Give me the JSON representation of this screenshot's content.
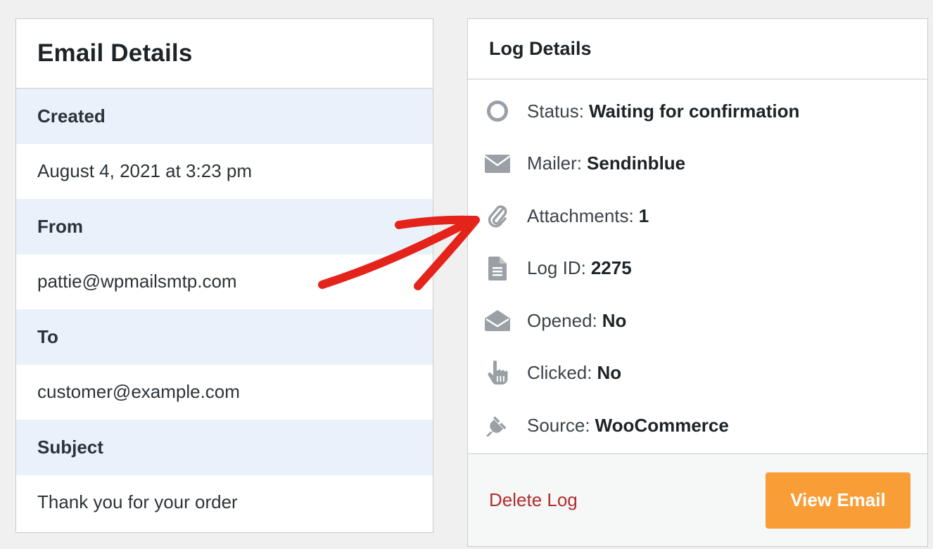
{
  "email_details": {
    "title": "Email Details",
    "rows": [
      {
        "label": "Created",
        "value": "August 4, 2021 at 3:23 pm"
      },
      {
        "label": "From",
        "value": "pattie@wpmailsmtp.com"
      },
      {
        "label": "To",
        "value": "customer@example.com"
      },
      {
        "label": "Subject",
        "value": "Thank you for your order"
      }
    ]
  },
  "log_details": {
    "title": "Log Details",
    "items": [
      {
        "icon": "status-circle-icon",
        "label": "Status:",
        "value": "Waiting for confirmation"
      },
      {
        "icon": "envelope-icon",
        "label": "Mailer:",
        "value": "Sendinblue"
      },
      {
        "icon": "paperclip-icon",
        "label": "Attachments:",
        "value": "1"
      },
      {
        "icon": "document-icon",
        "label": "Log ID:",
        "value": "2275"
      },
      {
        "icon": "open-envelope-icon",
        "label": "Opened:",
        "value": "No"
      },
      {
        "icon": "pointer-hand-icon",
        "label": "Clicked:",
        "value": "No"
      },
      {
        "icon": "plug-icon",
        "label": "Source:",
        "value": "WooCommerce"
      }
    ],
    "delete_label": "Delete Log",
    "view_label": "View Email"
  },
  "colors": {
    "label_row_bg": "#e9f2fb",
    "delete_text": "#b32d2e",
    "view_button": "#f99d36",
    "arrow": "#e4231b",
    "icon_gray": "#9aa0a6"
  }
}
